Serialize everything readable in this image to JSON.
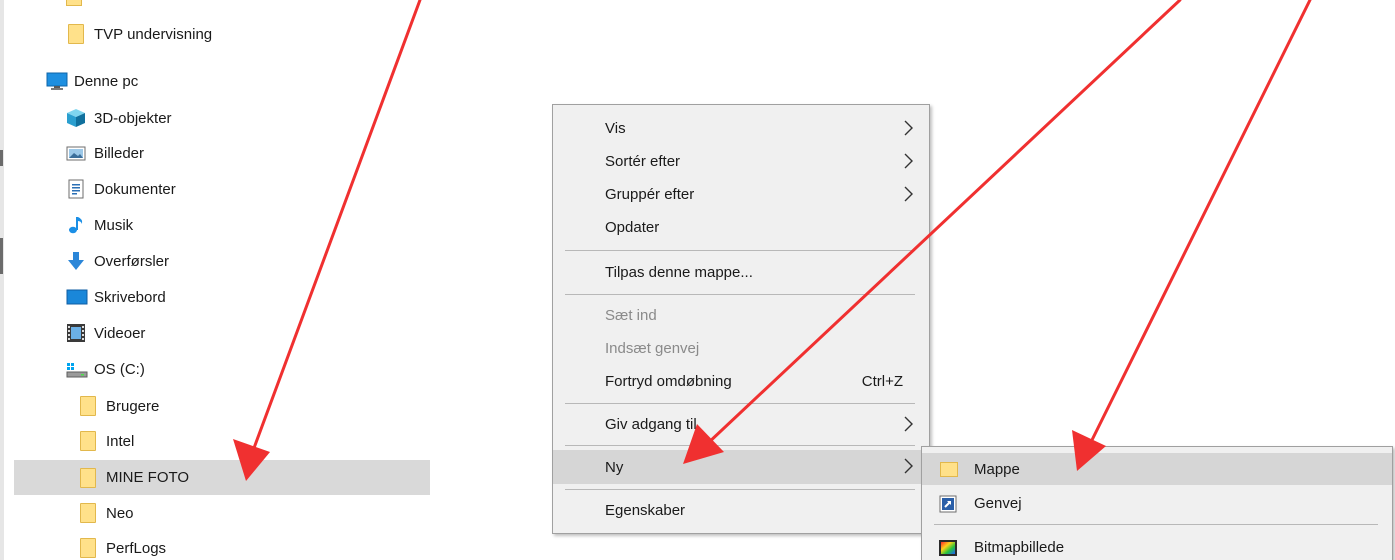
{
  "nav": {
    "items": [
      {
        "label": "TVP undervisning",
        "icon": "folder-icon",
        "indent": 1
      },
      {
        "label": "Denne pc",
        "icon": "computer-icon",
        "indent": 0
      },
      {
        "label": "3D-objekter",
        "icon": "3d-objects-icon",
        "indent": 1
      },
      {
        "label": "Billeder",
        "icon": "pictures-icon",
        "indent": 1
      },
      {
        "label": "Dokumenter",
        "icon": "documents-icon",
        "indent": 1
      },
      {
        "label": "Musik",
        "icon": "music-icon",
        "indent": 1
      },
      {
        "label": "Overførsler",
        "icon": "download-icon",
        "indent": 1
      },
      {
        "label": "Skrivebord",
        "icon": "desktop-icon",
        "indent": 1
      },
      {
        "label": "Videoer",
        "icon": "videos-icon",
        "indent": 1
      },
      {
        "label": "OS (C:)",
        "icon": "drive-icon",
        "indent": 1
      },
      {
        "label": "Brugere",
        "icon": "folder-icon",
        "indent": 2
      },
      {
        "label": "Intel",
        "icon": "folder-icon",
        "indent": 2
      },
      {
        "label": "MINE FOTO",
        "icon": "folder-icon",
        "indent": 2,
        "selected": true
      },
      {
        "label": "Neo",
        "icon": "folder-icon",
        "indent": 2
      },
      {
        "label": "PerfLogs",
        "icon": "folder-icon",
        "indent": 2
      }
    ]
  },
  "context_menu": {
    "items": [
      {
        "label": "Vis",
        "submenu": true
      },
      {
        "label": "Sortér efter",
        "submenu": true
      },
      {
        "label": "Gruppér efter",
        "submenu": true
      },
      {
        "label": "Opdater"
      },
      {
        "label": "Tilpas denne mappe..."
      },
      {
        "label": "Sæt ind",
        "disabled": true
      },
      {
        "label": "Indsæt genvej",
        "disabled": true
      },
      {
        "label": "Fortryd omdøbning",
        "shortcut": "Ctrl+Z"
      },
      {
        "label": "Giv adgang til",
        "submenu": true
      },
      {
        "label": "Ny",
        "submenu": true,
        "highlighted": true
      },
      {
        "label": "Egenskaber"
      }
    ]
  },
  "submenu_new": {
    "items": [
      {
        "label": "Mappe",
        "icon": "folder-icon",
        "highlighted": true
      },
      {
        "label": "Genvej",
        "icon": "shortcut-icon"
      },
      {
        "label": "Bitmapbillede",
        "icon": "bitmap-icon"
      }
    ]
  },
  "colors": {
    "annotation_arrow": "#f03030",
    "selection": "#d9d9d9",
    "menu_bg": "#f0f0f0",
    "menu_hover": "#d6d6d6"
  }
}
